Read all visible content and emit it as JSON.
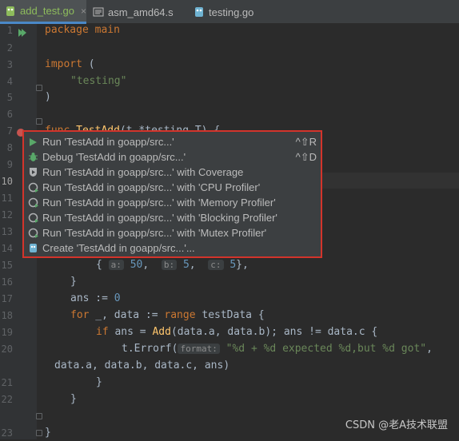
{
  "tabs": [
    {
      "label": "add_test.go",
      "close": "×"
    },
    {
      "label": "asm_amd64.s"
    },
    {
      "label": "testing.go"
    }
  ],
  "line_numbers": [
    "1",
    "2",
    "3",
    "4",
    "5",
    "6",
    "7",
    "8",
    "9",
    "10",
    "11",
    "12",
    "13",
    "14",
    "15",
    "16",
    "17",
    "18",
    "19",
    "20",
    "",
    "21",
    "22",
    "23"
  ],
  "code": {
    "l1": "package main",
    "l3_kw": "import",
    "l3_rest": " (",
    "l4_str": "\"testing\"",
    "l5": ")",
    "l7_kw": "func ",
    "l7_fn": "TestAdd",
    "l7_rest": "(t *testing.T) {",
    "l15_pre": "{ ",
    "l15_h1": "a:",
    "l15_v1": " 50",
    "l15_sep1": ",  ",
    "l15_h2": "b:",
    "l15_v2": " 5",
    "l15_sep2": ",  ",
    "l15_h3": "c:",
    "l15_v3": " 5",
    "l15_post": "},",
    "l16": "}",
    "l17_pre": "ans := ",
    "l17_num": "0",
    "l18_kw": "for",
    "l18_mid": " _, data := ",
    "l18_kw2": "range",
    "l18_post": " testData {",
    "l19_kw": "if",
    "l19_mid": " ans = ",
    "l19_fn": "Add",
    "l19_post": "(data.a, data.b); ans != data.c {",
    "l20_pre": "t.Errorf(",
    "l20_hint": "format:",
    "l20_str": "\"%d + %d expected %d,but %d got\"",
    "l20_post": ",",
    "l20b": "data.a, data.b, data.c, ans)",
    "l21": "}",
    "l22": "}",
    "l23": "}"
  },
  "menu": [
    {
      "label": "Run 'TestAdd in goapp/src...'",
      "shortcut": "^⇧R",
      "icon": "run-icon"
    },
    {
      "label": "Debug 'TestAdd in goapp/src...'",
      "shortcut": "^⇧D",
      "icon": "debug-icon"
    },
    {
      "label": "Run 'TestAdd in goapp/src...' with Coverage",
      "icon": "coverage-icon"
    },
    {
      "label": "Run 'TestAdd in goapp/src...' with 'CPU Profiler'",
      "icon": "profiler-icon"
    },
    {
      "label": "Run 'TestAdd in goapp/src...' with 'Memory Profiler'",
      "icon": "profiler-icon"
    },
    {
      "label": "Run 'TestAdd in goapp/src...' with 'Blocking Profiler'",
      "icon": "profiler-icon"
    },
    {
      "label": "Run 'TestAdd in goapp/src...' with 'Mutex Profiler'",
      "icon": "profiler-icon"
    },
    {
      "label": "Create 'TestAdd in goapp/src...'...",
      "icon": "create-config-icon"
    }
  ],
  "watermark": "CSDN @老A技术联盟",
  "colors": {
    "keyword": "#cc7832",
    "string": "#6a8759",
    "number": "#6897bb",
    "function": "#ffc66d",
    "highlight_border": "#d3342b"
  }
}
